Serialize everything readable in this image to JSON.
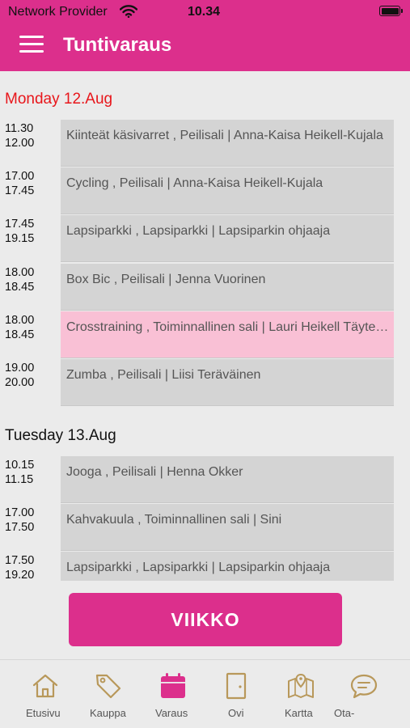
{
  "status_bar": {
    "carrier": "Network Provider",
    "time": "10.34"
  },
  "header": {
    "title": "Tuntivaraus"
  },
  "days": [
    {
      "title": "Monday 12.Aug",
      "slots": [
        {
          "start": "11.30",
          "end": "12.00",
          "label": "Kiinteät käsivarret , Peilisali | Anna-Kaisa Heikell-Kujala"
        },
        {
          "start": "17.00",
          "end": "17.45",
          "label": "Cycling , Peilisali | Anna-Kaisa Heikell-Kujala"
        },
        {
          "start": "17.45",
          "end": "19.15",
          "label": "Lapsiparkki , Lapsiparkki | Lapsiparkin ohjaaja"
        },
        {
          "start": "18.00",
          "end": "18.45",
          "label": "Box Bic , Peilisali | Jenna Vuorinen"
        },
        {
          "start": "18.00",
          "end": "18.45",
          "label": "Crosstraining , Toiminnallinen sali | Lauri Heikell Täyteen varattu"
        },
        {
          "start": "19.00",
          "end": "20.00",
          "label": "Zumba , Peilisali | Liisi Teräväinen"
        }
      ]
    },
    {
      "title": "Tuesday 13.Aug",
      "slots": [
        {
          "start": "10.15",
          "end": "11.15",
          "label": "Jooga , Peilisali | Henna Okker"
        },
        {
          "start": "17.00",
          "end": "17.50",
          "label": "Kahvakuula , Toiminnallinen sali | Sini"
        },
        {
          "start": "17.50",
          "end": "19.20",
          "label": "Lapsiparkki , Lapsiparkki | Lapsiparkin ohjaaja"
        }
      ]
    }
  ],
  "week_button": {
    "label": "VIIKKO"
  },
  "tabs": [
    {
      "label": "Etusivu",
      "icon": "home-icon"
    },
    {
      "label": "Kauppa",
      "icon": "tag-icon"
    },
    {
      "label": "Varaus",
      "icon": "calendar-icon"
    },
    {
      "label": "Ovi",
      "icon": "door-icon"
    },
    {
      "label": "Kartta",
      "icon": "map-icon"
    },
    {
      "label": "Ota-",
      "icon": "chat-icon"
    }
  ],
  "colors": {
    "brand": "#dc2f8c",
    "today_red": "#e8161b",
    "highlight_card": "#f9c0d5",
    "card": "#d4d4d4",
    "tab_gold": "#b8985a"
  }
}
